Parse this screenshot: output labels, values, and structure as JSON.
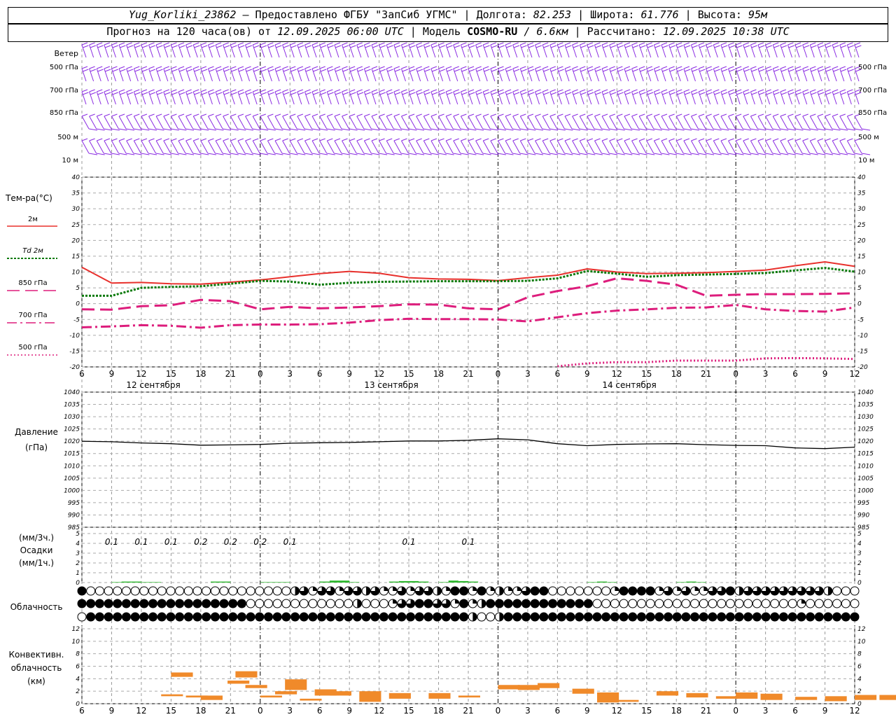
{
  "header": {
    "station": "Yug_Korliki_23862",
    "provider": " – Предоставлено ФГБУ \"ЗапСиб УГМС\" | Долгота: ",
    "lon": "82.253",
    "lat_label": " | Широта: ",
    "lat": "61.776",
    "alt_label": " | Высота: ",
    "alt": "95м",
    "forecast_label": "Прогноз на 120 часа(ов) от ",
    "forecast_start": "12.09.2025 06:00 UTC",
    "model_label": " | Модель ",
    "model": "COSMO-RU",
    "res": " / 6.6км",
    "calc_label": " | Рассчитано: ",
    "calc_time": "12.09.2025 10:38 UTC"
  },
  "wind_panel": {
    "title": "Ветер",
    "levels": [
      "500 гПа",
      "700 гПа",
      "850 гПа",
      "500 м",
      "10 м"
    ]
  },
  "temp_panel": {
    "title": "Тем-ра(°С)",
    "legend": [
      "2м",
      "Td 2м",
      "850 гПа",
      "700 гПа",
      "500 гПа"
    ]
  },
  "pressure_panel": {
    "title1": "Давление",
    "title2": "(гПа)"
  },
  "precip_panel": {
    "unit3": "(мм/3ч.)",
    "title": "Осадки",
    "unit1": "(мм/1ч.)"
  },
  "cloud_panel": {
    "title": "Облачность"
  },
  "conv_panel": {
    "title1": "Конвективн.",
    "title2": "облачность",
    "title3": "(км)"
  },
  "x_ticks": [
    "6",
    "9",
    "12",
    "15",
    "18",
    "21",
    "0",
    "3",
    "6",
    "9",
    "12",
    "15",
    "18",
    "21",
    "0",
    "3",
    "6",
    "9",
    "12",
    "15",
    "18",
    "21",
    "0",
    "3",
    "6",
    "9",
    "12"
  ],
  "dates": [
    "12 сентября",
    "13 сентября",
    "14 сентября"
  ],
  "chart_data": [
    {
      "type": "line",
      "title": "Тем-ра(°С)",
      "x": [
        6,
        9,
        12,
        15,
        18,
        21,
        0,
        3,
        6,
        9,
        12,
        15,
        18,
        21,
        0,
        3,
        6,
        9,
        12,
        15,
        18,
        21,
        0,
        3,
        6,
        9,
        12
      ],
      "ylim": [
        -20,
        40
      ],
      "yticks": [
        -20,
        -15,
        -10,
        -5,
        0,
        5,
        10,
        15,
        20,
        25,
        30,
        35,
        40
      ],
      "colors": {
        "t2m": "#e8302c",
        "td2m": "#0a7a0a",
        "t850": "#dd1d7c",
        "t700": "#dd1d7c",
        "t500": "#dd1d7c"
      },
      "series": [
        {
          "name": "2м",
          "values": [
            11.5,
            6.5,
            6.7,
            6.3,
            6.2,
            6.8,
            7.5,
            8.5,
            9.5,
            10.2,
            9.6,
            8.2,
            7.8,
            7.7,
            7.3,
            8.2,
            9.0,
            11.0,
            10.0,
            9.5,
            9.6,
            9.8,
            10.2,
            10.6,
            12.0,
            13.2,
            11.8
          ]
        },
        {
          "name": "Td 2м",
          "values": [
            2.5,
            2.5,
            5.0,
            5.3,
            5.5,
            6.3,
            7.2,
            7.0,
            6.0,
            6.6,
            6.9,
            7.0,
            7.1,
            7.1,
            7.1,
            7.2,
            8.0,
            10.3,
            9.5,
            8.5,
            9.0,
            9.2,
            9.4,
            9.7,
            10.5,
            11.3,
            10.1
          ]
        },
        {
          "name": "850 гПа",
          "values": [
            -1.8,
            -1.9,
            -0.8,
            -0.5,
            1.2,
            0.8,
            -1.8,
            -1.0,
            -1.5,
            -1.2,
            -0.8,
            -0.2,
            -0.3,
            -1.5,
            -1.8,
            2.0,
            4.0,
            5.5,
            8.0,
            7.2,
            6.0,
            2.5,
            2.8,
            3.0,
            3.0,
            3.1,
            3.3
          ]
        },
        {
          "name": "700 гПа",
          "values": [
            -7.5,
            -7.2,
            -6.8,
            -7.0,
            -7.6,
            -6.8,
            -6.6,
            -6.6,
            -6.5,
            -6.0,
            -5.2,
            -4.8,
            -4.9,
            -4.9,
            -5.0,
            -5.6,
            -4.3,
            -3.0,
            -2.2,
            -1.8,
            -1.3,
            -1.2,
            -0.4,
            -1.8,
            -2.3,
            -2.5,
            -1.2
          ]
        },
        {
          "name": "500 гПа",
          "x": [
            6,
            9,
            12,
            15,
            18,
            21,
            0,
            3,
            6,
            9,
            12
          ],
          "values": [
            -19.8,
            -18.9,
            -18.5,
            -18.5,
            -18.0,
            -18.0,
            -18.0,
            -17.3,
            -17.2,
            -17.3,
            -17.5
          ]
        }
      ]
    },
    {
      "type": "line",
      "title": "Давление",
      "ylabel": "(гПа)",
      "ylim": [
        985,
        1040
      ],
      "yticks": [
        985,
        990,
        995,
        1000,
        1005,
        1010,
        1015,
        1020,
        1025,
        1030,
        1035,
        1040
      ],
      "x": [
        6,
        9,
        12,
        15,
        18,
        21,
        0,
        3,
        6,
        9,
        12,
        15,
        18,
        21,
        0,
        3,
        6,
        9,
        12,
        15,
        18,
        21,
        0,
        3,
        6,
        9,
        12
      ],
      "series": [
        {
          "name": "",
          "values": [
            1020,
            1019.8,
            1019.3,
            1019.0,
            1018.4,
            1018.5,
            1018.7,
            1019.2,
            1019.4,
            1019.5,
            1019.8,
            1020.1,
            1020.1,
            1020.4,
            1021.0,
            1020.6,
            1019.0,
            1018.2,
            1018.7,
            1018.9,
            1019.0,
            1018.6,
            1018.3,
            1018.2,
            1017.3,
            1017.0,
            1017.6
          ]
        }
      ]
    },
    {
      "type": "bar",
      "title": "Осадки",
      "ylabel": "(мм/1ч.)",
      "ylim": [
        0,
        5
      ],
      "labels_3h": [
        "0.1",
        "0.1",
        "0.1",
        "0.2",
        "0.2",
        "0.2",
        "0.1",
        "0.1",
        "0.1"
      ],
      "labels_3h_at": [
        9,
        12,
        15,
        18,
        21,
        0,
        3,
        15,
        21
      ],
      "color": "#2bb52b"
    },
    {
      "type": "bar",
      "title": "Конвективн. облачность (км)",
      "ylim": [
        0,
        12
      ],
      "color": "#f08a2a",
      "bars": [
        {
          "x": 9,
          "bottom": 1.2,
          "top": 1.5
        },
        {
          "x": 10,
          "bottom": 4.3,
          "top": 5.0
        },
        {
          "x": 11.5,
          "bottom": 1.0,
          "top": 1.3
        },
        {
          "x": 13,
          "bottom": 0.6,
          "top": 1.3
        },
        {
          "x": 15.7,
          "bottom": 3.2,
          "top": 3.7
        },
        {
          "x": 16.5,
          "bottom": 4.2,
          "top": 5.2
        },
        {
          "x": 17.5,
          "bottom": 2.5,
          "top": 3.0
        },
        {
          "x": 19,
          "bottom": 1.0,
          "top": 1.3
        },
        {
          "x": 20.5,
          "bottom": 1.5,
          "top": 2.0
        },
        {
          "x": 21.5,
          "bottom": 2.2,
          "top": 3.9
        },
        {
          "x": 23,
          "bottom": 0.5,
          "top": 0.8
        },
        {
          "x": 24.5,
          "bottom": 1.3,
          "top": 2.3
        },
        {
          "x": 26,
          "bottom": 1.3,
          "top": 2.0
        },
        {
          "x": 29,
          "bottom": 0.3,
          "top": 2.0
        },
        {
          "x": 32,
          "bottom": 0.8,
          "top": 1.7
        },
        {
          "x": 36,
          "bottom": 0.8,
          "top": 1.7
        },
        {
          "x": 39,
          "bottom": 1.0,
          "top": 1.3
        },
        {
          "x": 43,
          "bottom": 2.3,
          "top": 3.0
        },
        {
          "x": 45,
          "bottom": 2.2,
          "top": 3.0
        },
        {
          "x": 47,
          "bottom": 2.5,
          "top": 3.3
        },
        {
          "x": 50.5,
          "bottom": 1.6,
          "top": 2.4
        },
        {
          "x": 53,
          "bottom": 0.2,
          "top": 1.8
        },
        {
          "x": 55,
          "bottom": 0.3,
          "top": 0.6
        },
        {
          "x": 59,
          "bottom": 1.3,
          "top": 2.0
        },
        {
          "x": 62,
          "bottom": 1.0,
          "top": 1.7
        },
        {
          "x": 65,
          "bottom": 0.8,
          "top": 1.2
        },
        {
          "x": 67,
          "bottom": 0.8,
          "top": 1.8
        },
        {
          "x": 69.5,
          "bottom": 0.6,
          "top": 1.6
        },
        {
          "x": 73,
          "bottom": 0.6,
          "top": 1.1
        },
        {
          "x": 76,
          "bottom": 0.4,
          "top": 1.2
        },
        {
          "x": 79,
          "bottom": 0.6,
          "top": 1.4
        },
        {
          "x": 81.5,
          "bottom": 0.6,
          "top": 1.4
        },
        {
          "x": 85,
          "bottom": 1.5,
          "top": 2.2
        },
        {
          "x": 87.5,
          "bottom": 1.6,
          "top": 2.3
        },
        {
          "x": 93,
          "bottom": 0.3,
          "top": 0.5
        },
        {
          "x": 99,
          "bottom": 0.3,
          "top": 0.5
        },
        {
          "x": 101.5,
          "bottom": 0.6,
          "top": 2.2
        },
        {
          "x": 104,
          "bottom": 1.2,
          "top": 2.0
        },
        {
          "x": 106.5,
          "bottom": 1.3,
          "top": 2.2
        },
        {
          "x": 108.5,
          "bottom": 1.6,
          "top": 2.1
        },
        {
          "x": 110.5,
          "bottom": 1.6,
          "top": 2.1
        }
      ]
    }
  ]
}
